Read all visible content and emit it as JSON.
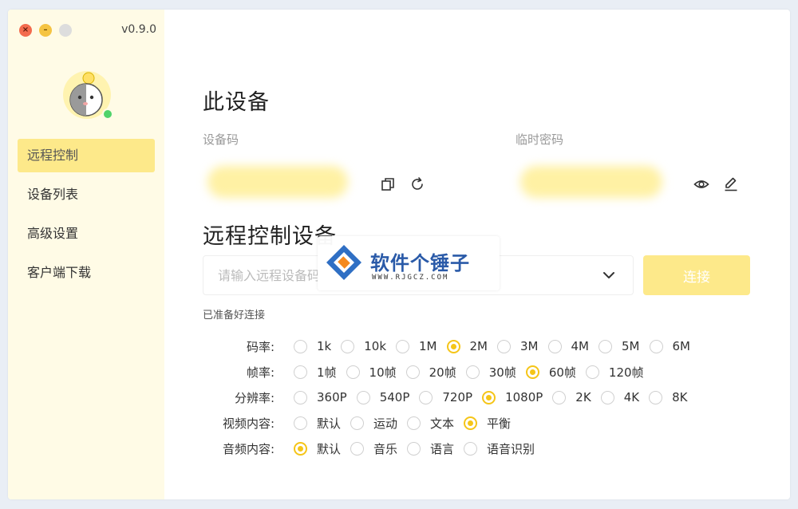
{
  "window": {
    "version": "v0.9.0"
  },
  "sidebar": {
    "items": [
      {
        "label": "远程控制",
        "active": true
      },
      {
        "label": "设备列表",
        "active": false
      },
      {
        "label": "高级设置",
        "active": false
      },
      {
        "label": "客户端下载",
        "active": false
      }
    ]
  },
  "this_device": {
    "title": "此设备",
    "device_code_label": "设备码",
    "temp_password_label": "临时密码"
  },
  "remote": {
    "title": "远程控制设备",
    "input_placeholder": "请输入远程设备码",
    "connect_label": "连接",
    "status": "已准备好连接"
  },
  "options": [
    {
      "label": "码率:",
      "choices": [
        "1k",
        "10k",
        "1M",
        "2M",
        "3M",
        "4M",
        "5M",
        "6M"
      ],
      "selected": "2M"
    },
    {
      "label": "帧率:",
      "choices": [
        "1帧",
        "10帧",
        "20帧",
        "30帧",
        "60帧",
        "120帧"
      ],
      "selected": "60帧"
    },
    {
      "label": "分辨率:",
      "choices": [
        "360P",
        "540P",
        "720P",
        "1080P",
        "2K",
        "4K",
        "8K"
      ],
      "selected": "1080P"
    },
    {
      "label": "视频内容:",
      "choices": [
        "默认",
        "运动",
        "文本",
        "平衡"
      ],
      "selected": "平衡"
    },
    {
      "label": "音频内容:",
      "choices": [
        "默认",
        "音乐",
        "语言",
        "语音识别"
      ],
      "selected": "默认"
    }
  ],
  "watermark": {
    "title": "软件个锤子",
    "url": "WWW.RJGCZ.COM"
  },
  "colors": {
    "accent": "#f5c518",
    "sidebar_bg": "#fffbe6",
    "active_item": "#fde98a",
    "online": "#4fd36b"
  }
}
